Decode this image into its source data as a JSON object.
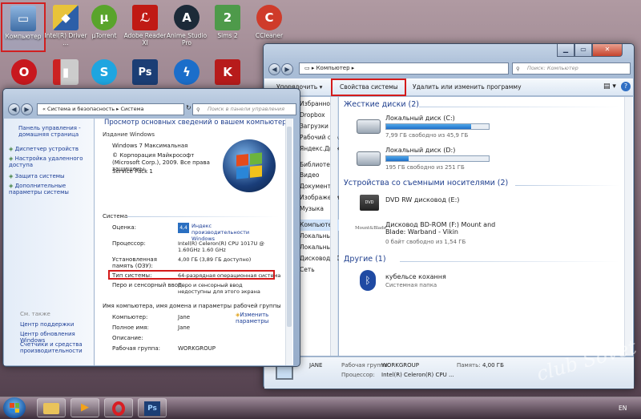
{
  "desktop_icons": [
    {
      "label": "Компьютер",
      "icon": "computer-icon",
      "color": "#4d7fb7"
    },
    {
      "label": "Intel(R) Driver ...",
      "icon": "shield-icon",
      "color": "#2c5fa8"
    },
    {
      "label": "µTorrent",
      "icon": "utorrent-icon",
      "color": "#59a42b"
    },
    {
      "label": "Adobe Reader XI",
      "icon": "pdf-icon",
      "color": "#c01a14"
    },
    {
      "label": "Anime Studio Pro",
      "icon": "anime-studio-icon",
      "color": "#1c2a38"
    },
    {
      "label": "Sims 2",
      "icon": "sims-icon",
      "color": "#4e9a4a"
    },
    {
      "label": "CCleaner",
      "icon": "ccleaner-icon",
      "color": "#cf3b2a"
    },
    {
      "label": "",
      "icon": "opera-icon",
      "color": "#c8181e"
    },
    {
      "label": "",
      "icon": "app-icon",
      "color": "#565656"
    },
    {
      "label": "",
      "icon": "skype-icon",
      "color": "#1ea5e0"
    },
    {
      "label": "",
      "icon": "photoshop-icon",
      "color": "#1b3e75"
    },
    {
      "label": "",
      "icon": "bolt-icon",
      "color": "#1b6eca"
    },
    {
      "label": "",
      "icon": "kaspersky-icon",
      "color": "#b71b1b"
    }
  ],
  "right_window": {
    "address": "Компьютер",
    "search_placeholder": "Поиск: Компьютер",
    "toolbar": {
      "organize": "Упорядочить",
      "system_props": "Свойства системы",
      "uninstall": "Удалить или изменить программу"
    },
    "partial_nav": [
      "Упорядочить",
      "Избранное",
      "Dropbox",
      "Загрузки",
      "Рабочий стол",
      "Яндекс.Диск",
      "Библиотеки",
      "Видео",
      "Документы",
      "Изображения",
      "Музыка",
      "Компьютер",
      "Локальный",
      "Локальный",
      "Дисковод BD-",
      "Сеть"
    ],
    "sections": {
      "hard_disks": "Жесткие диски (2)",
      "removable": "Устройства со съемными носителями (2)",
      "other": "Другие (1)"
    },
    "drives": [
      {
        "name": "Локальный диск (C:)",
        "free": "7,99 ГБ свободно из 45,9 ГБ",
        "used": 0.83
      },
      {
        "name": "Локальный диск (D:)",
        "free": "195 ГБ свободно из 251 ГБ",
        "used": 0.22
      }
    ],
    "dvd": {
      "name": "DVD RW дисковод (E:)"
    },
    "bd": {
      "name_line1": "Дисковод BD-ROM (F:) Mount and",
      "name_line2": "Blade: Warband - Vikin",
      "free": "0 байт свободно из 1,54 ГБ",
      "icon_text": "Mount&Blade"
    },
    "other_item": {
      "name": "кубельсе кохання",
      "type": "Системная папка"
    },
    "details": {
      "user": "JANE",
      "workgroup_label": "Рабочая группа:",
      "workgroup": "WORKGROUP",
      "memory_label": "Память:",
      "memory": "4,00 ГБ",
      "cpu_label": "Процессор:",
      "cpu": "Intel(R) Celeron(R) CPU ..."
    }
  },
  "left_window": {
    "breadcrumb": "« Система и безопасность ▸ Система",
    "search_placeholder": "Поиск в панели управления",
    "sidebar": {
      "home": "Панель управления - домашняя страница",
      "items": [
        "Диспетчер устройств",
        "Настройка удаленного доступа",
        "Защита системы",
        "Дополнительные параметры системы"
      ],
      "see_also": "См. также",
      "see_items": [
        "Центр поддержки",
        "Центр обновления Windows",
        "Счетчики и средства производительности"
      ]
    },
    "title": "Просмотр основных сведений о вашем компьютере",
    "edition_header": "Издание Windows",
    "edition": "Windows 7 Максимальная",
    "copyright": "© Корпорация Майкрософт (Microsoft Corp.), 2009. Все права защищены.",
    "sp": "Service Pack 1",
    "system_header": "Система",
    "rows": [
      {
        "label": "Оценка:",
        "value": "Индекс производительности Windows",
        "badge": "4,4"
      },
      {
        "label": "Процессор:",
        "value": "Intel(R) Celeron(R) CPU 1017U @ 1.60GHz 1.60 GHz"
      },
      {
        "label": "Установленная память (ОЗУ):",
        "value": "4,00 ГБ (3,89 ГБ доступно)"
      },
      {
        "label": "Тип системы:",
        "value": "64-разрядная операционная система"
      },
      {
        "label": "Перо и сенсорный ввод:",
        "value": "Перо и сенсорный ввод недоступны для этого экрана"
      }
    ],
    "name_header": "Имя компьютера, имя домена и параметры рабочей группы",
    "name_rows": [
      {
        "label": "Компьютер:",
        "value": "Jane"
      },
      {
        "label": "Полное имя:",
        "value": "Jane"
      },
      {
        "label": "Описание:",
        "value": ""
      },
      {
        "label": "Рабочая группа:",
        "value": "WORKGROUP"
      }
    ],
    "change_params": "Изменить параметры"
  },
  "taskbar": {
    "lang": "EN"
  },
  "watermark": "club Sovet"
}
